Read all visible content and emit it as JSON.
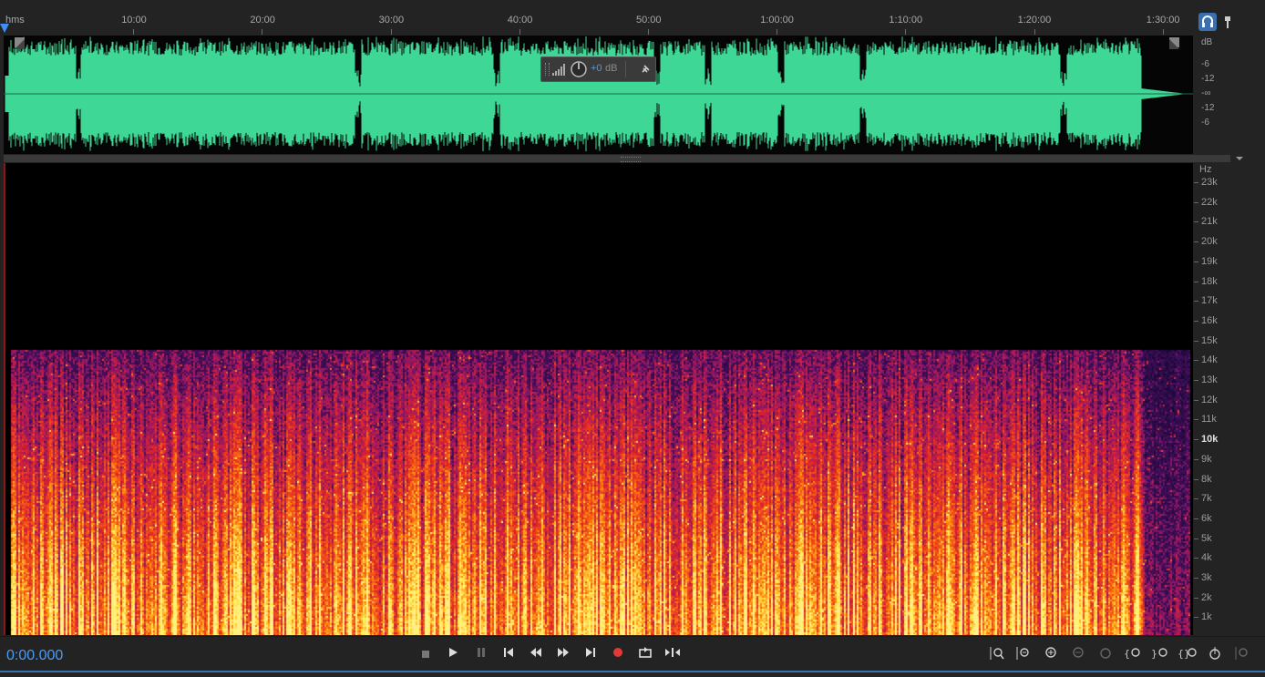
{
  "ruler": {
    "unit_label": "hms",
    "ticks": [
      "10:00",
      "20:00",
      "30:00",
      "40:00",
      "50:00",
      "1:00:00",
      "1:10:00",
      "1:20:00",
      "1:30:00"
    ]
  },
  "waveform": {
    "color": "#3ed795",
    "db_label": "dB",
    "db_scale": [
      "-6",
      "-12",
      "-∞",
      "-12",
      "-6"
    ]
  },
  "hud": {
    "gain_value": "+0",
    "gain_unit": "dB",
    "knob_icon": "volume-knob-icon",
    "pin_icon": "pin-icon"
  },
  "spectrum": {
    "unit_label": "Hz",
    "freq_labels": [
      "23k",
      "22k",
      "21k",
      "20k",
      "19k",
      "18k",
      "17k",
      "16k",
      "15k",
      "14k",
      "13k",
      "12k",
      "11k",
      "10k",
      "9k",
      "8k",
      "7k",
      "6k",
      "5k",
      "4k",
      "3k",
      "2k",
      "1k"
    ],
    "colors": {
      "high": "#ffe070",
      "mid": "#e0202a",
      "low": "#6a2a8a"
    }
  },
  "transport": {
    "timecode": "0:00.000",
    "accent": "#4a9cf6",
    "record_color": "#e53935",
    "buttons": [
      "stop",
      "play",
      "pause",
      "go-to-start",
      "rewind",
      "fast-forward",
      "go-to-end",
      "record",
      "loop",
      "skip-selection"
    ],
    "zoom_buttons": [
      "zoom-in-amplitude",
      "zoom-out-amplitude",
      "zoom-in-full",
      "zoom-out-full",
      "zoom-selection",
      "zoom-in-left",
      "zoom-in-right",
      "zoom-out-full-time",
      "zoom-to-playhead",
      "zoom-amplitude-reset"
    ]
  }
}
